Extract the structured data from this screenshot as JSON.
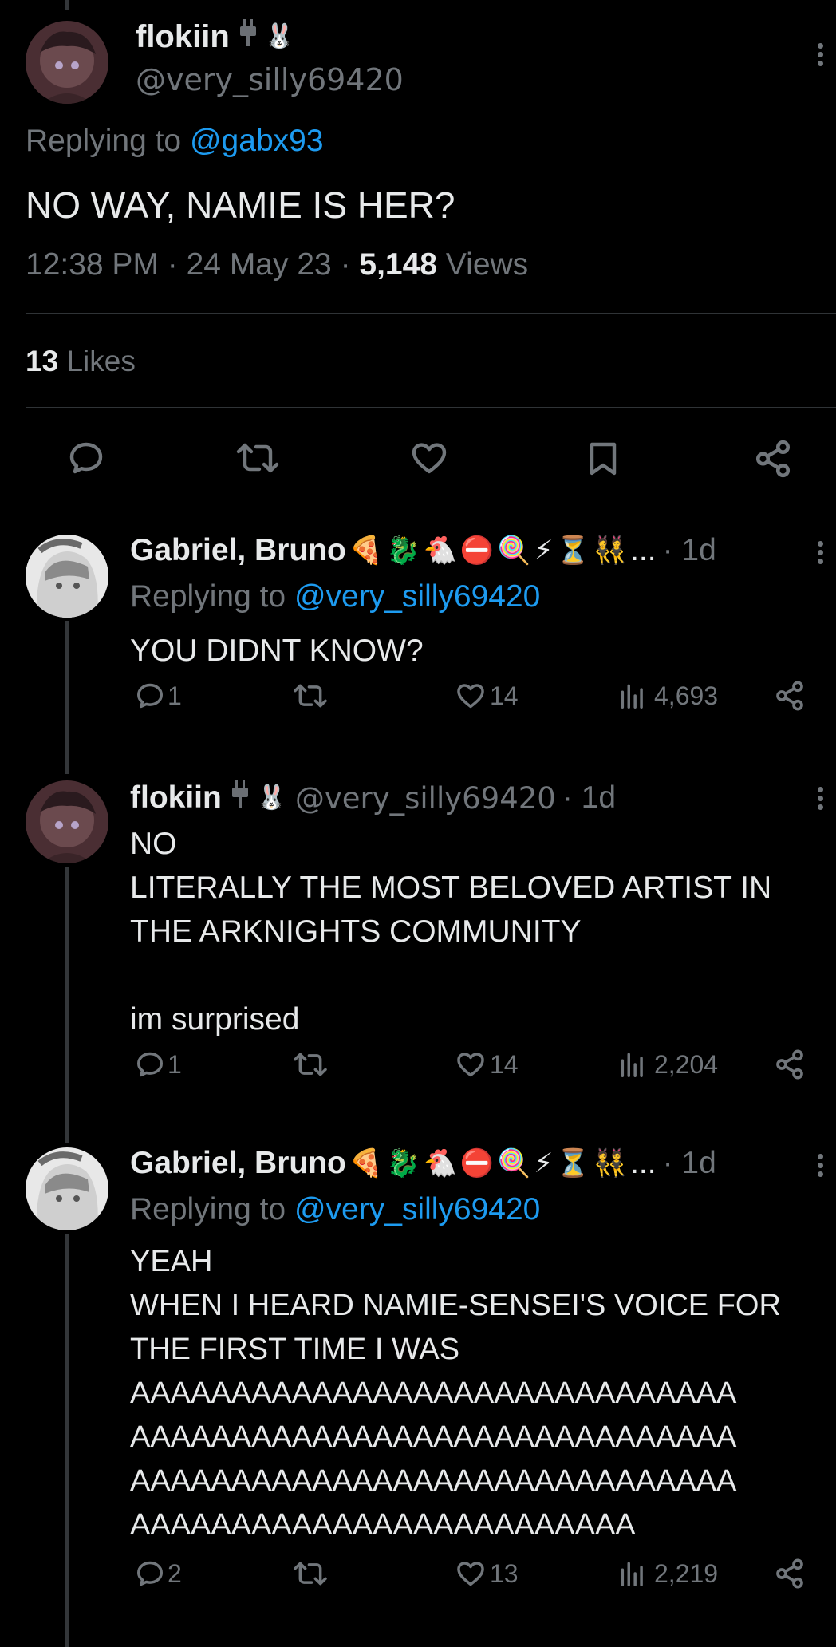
{
  "main_tweet": {
    "name": "flokiin",
    "handle": "@very_silly69420",
    "replying_prefix": "Replying to",
    "replying_to": "@gabx93",
    "text": "NO WAY, NAMIE IS HER?",
    "time": "12:38 PM",
    "date": "24 May 23",
    "views_count": "5,148",
    "views_label": "Views",
    "likes_count": "13",
    "likes_label": "Likes"
  },
  "replies": [
    {
      "name": "Gabriel, Bruno",
      "name_emojis": "🍕🐉🐔⛔🍭⚡⏳👯",
      "ellipsis": "...",
      "time": "· 1d",
      "replying_prefix": "Replying to",
      "replying_to": "@very_silly69420",
      "text": "YOU DIDNT KNOW?",
      "reply_count": "1",
      "like_count": "14",
      "view_count": "4,693"
    },
    {
      "name": "flokiin",
      "handle": "@very_silly69420",
      "time": "· 1d",
      "text": "NO\nLITERALLY THE MOST BELOVED ARTIST IN\nTHE ARKNIGHTS COMMUNITY\n\nim surprised",
      "reply_count": "1",
      "like_count": "14",
      "view_count": "2,204"
    },
    {
      "name": "Gabriel, Bruno",
      "name_emojis": "🍕🐉🐔⛔🍭⚡⏳👯",
      "ellipsis": "...",
      "time": "· 1d",
      "replying_prefix": "Replying to",
      "replying_to": "@very_silly69420",
      "text": "YEAH\nWHEN I HEARD NAMIE-SENSEI'S VOICE FOR\nTHE FIRST TIME I WAS\nAAAAAAAAAAAAAAAAAAAAAAAAAAAAAA\nAAAAAAAAAAAAAAAAAAAAAAAAAAAAAA\nAAAAAAAAAAAAAAAAAAAAAAAAAAAAAA\nAAAAAAAAAAAAAAAAAAAAAAAAA",
      "reply_count": "2",
      "like_count": "13",
      "view_count": "2,219"
    }
  ],
  "icons": {
    "plug": "plug-icon",
    "rabbit": "🐰"
  },
  "colors": {
    "background": "#000000",
    "text": "#e7e9ea",
    "muted": "#71767b",
    "link": "#1d9bf0",
    "divider": "#2f3336"
  }
}
